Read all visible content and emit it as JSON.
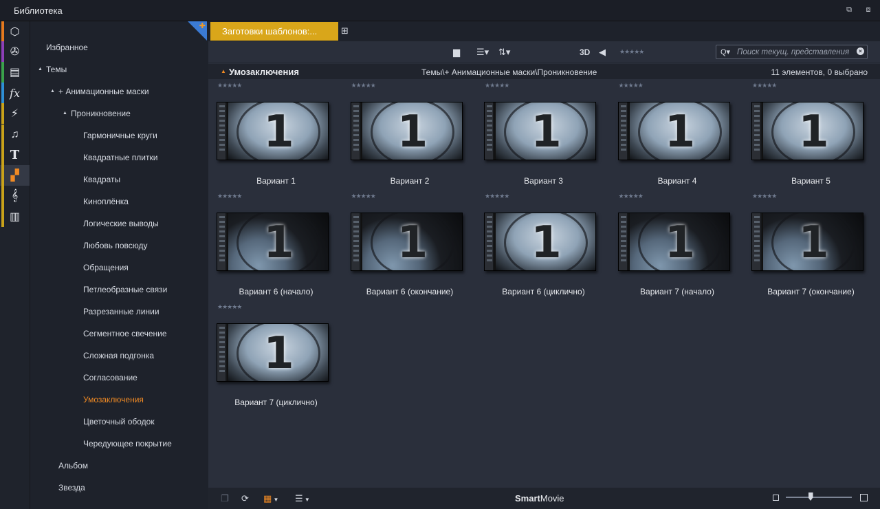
{
  "window": {
    "title": "Библиотека",
    "restore_icon": "restore-icon",
    "popout_icon": "popout-icon"
  },
  "categories": [
    {
      "name": "media",
      "icon": "box-icon",
      "glyph": "⬡",
      "stripe": "#e5791e"
    },
    {
      "name": "projects",
      "icon": "film-reel-icon",
      "glyph": "✇",
      "stripe": "#8d3fb8"
    },
    {
      "name": "collections",
      "icon": "stack-icon",
      "glyph": "▤",
      "stripe": "#3aa24b"
    },
    {
      "name": "effects",
      "icon": "fx-icon",
      "glyph": "fx",
      "stripe": "#2e8fd6"
    },
    {
      "name": "transitions",
      "icon": "lightning-icon",
      "glyph": "⚡",
      "stripe": "#c9a21a"
    },
    {
      "name": "audio",
      "icon": "music-note-icon",
      "glyph": "♫",
      "stripe": "#c9a21a"
    },
    {
      "name": "titles",
      "icon": "title-t-icon",
      "glyph": "T",
      "stripe": "#c9a21a"
    },
    {
      "name": "templates",
      "icon": "template-blocks-icon",
      "glyph": "▞",
      "stripe": "#c9a21a"
    },
    {
      "name": "scorefitter",
      "icon": "treble-clef-icon",
      "glyph": "𝄞",
      "stripe": "#c9a21a"
    },
    {
      "name": "keyboard",
      "icon": "piano-keys-icon",
      "glyph": "▥",
      "stripe": "#c9a21a"
    }
  ],
  "tree": {
    "items": [
      {
        "label": "Избранное",
        "level": 0,
        "expand": ""
      },
      {
        "label": "Темы",
        "level": 0,
        "expand": "▲"
      },
      {
        "label": "+ Анимационные маски",
        "level": 1,
        "expand": "▲"
      },
      {
        "label": "Проникновение",
        "level": 2,
        "expand": "▲"
      },
      {
        "label": "Гармоничные круги",
        "level": 3,
        "expand": ""
      },
      {
        "label": "Квадратные плитки",
        "level": 3,
        "expand": ""
      },
      {
        "label": "Квадраты",
        "level": 3,
        "expand": ""
      },
      {
        "label": "Киноплёнка",
        "level": 3,
        "expand": ""
      },
      {
        "label": "Логические выводы",
        "level": 3,
        "expand": ""
      },
      {
        "label": "Любовь повсюду",
        "level": 3,
        "expand": ""
      },
      {
        "label": "Обращения",
        "level": 3,
        "expand": ""
      },
      {
        "label": "Петлеобразные связи",
        "level": 3,
        "expand": ""
      },
      {
        "label": "Разрезанные линии",
        "level": 3,
        "expand": ""
      },
      {
        "label": "Сегментное свечение",
        "level": 3,
        "expand": ""
      },
      {
        "label": "Сложная подгонка",
        "level": 3,
        "expand": ""
      },
      {
        "label": "Согласование",
        "level": 3,
        "expand": ""
      },
      {
        "label": "Умозаключения",
        "level": 3,
        "expand": "",
        "selected": true
      },
      {
        "label": "Цветочный ободок",
        "level": 3,
        "expand": ""
      },
      {
        "label": "Чередующее покрытие",
        "level": 3,
        "expand": ""
      },
      {
        "label": "Альбом",
        "level": 2,
        "expand": ""
      },
      {
        "label": "Звезда",
        "level": 2,
        "expand": ""
      }
    ]
  },
  "tab": {
    "label": "Заготовки шаблонов:...",
    "add_icon": "add-tab-icon"
  },
  "toolbar": {
    "folder_icon": "folder-icon",
    "list_icon": "list-view-icon",
    "sort_icon": "sort-icon",
    "three_d": "3D",
    "tag_icon": "tag-icon",
    "rating_stars": "★★★★★"
  },
  "search": {
    "placeholder": "Поиск текущ. представления",
    "value": "",
    "icon": "search-icon",
    "clear_icon": "clear-search-icon"
  },
  "header": {
    "title": "Умозаключения",
    "path": "Темы\\+ Анимационные маски\\Проникновение",
    "count": "11 элементов, 0 выбрано"
  },
  "items": [
    {
      "label": "Вариант 1",
      "stars": "★★★★★",
      "style": "light"
    },
    {
      "label": "Вариант 2",
      "stars": "★★★★★",
      "style": "light"
    },
    {
      "label": "Вариант 3",
      "stars": "★★★★★",
      "style": "light"
    },
    {
      "label": "Вариант 4",
      "stars": "★★★★★",
      "style": "light"
    },
    {
      "label": "Вариант 5",
      "stars": "★★★★★",
      "style": "light"
    },
    {
      "label": "Вариант 6 (начало)",
      "stars": "★★★★★",
      "style": "dark"
    },
    {
      "label": "Вариант 6 (окончание)",
      "stars": "★★★★★",
      "style": "dark"
    },
    {
      "label": "Вариант 6 (циклично)",
      "stars": "★★★★★",
      "style": "light"
    },
    {
      "label": "Вариант 7 (начало)",
      "stars": "★★★★★",
      "style": "dark"
    },
    {
      "label": "Вариант 7 (окончание)",
      "stars": "★★★★★",
      "style": "dark"
    },
    {
      "label": "Вариант 7 (циклично)",
      "stars": "★★★★★",
      "style": "light"
    }
  ],
  "thumb_number": "1",
  "bottom": {
    "smart_bold": "Smart",
    "smart_rest": "Movie",
    "zoom_level": 0.37
  },
  "colors": {
    "accent": "#f08a24",
    "tab": "#d9a61a",
    "corner": "#3b7bd4"
  }
}
